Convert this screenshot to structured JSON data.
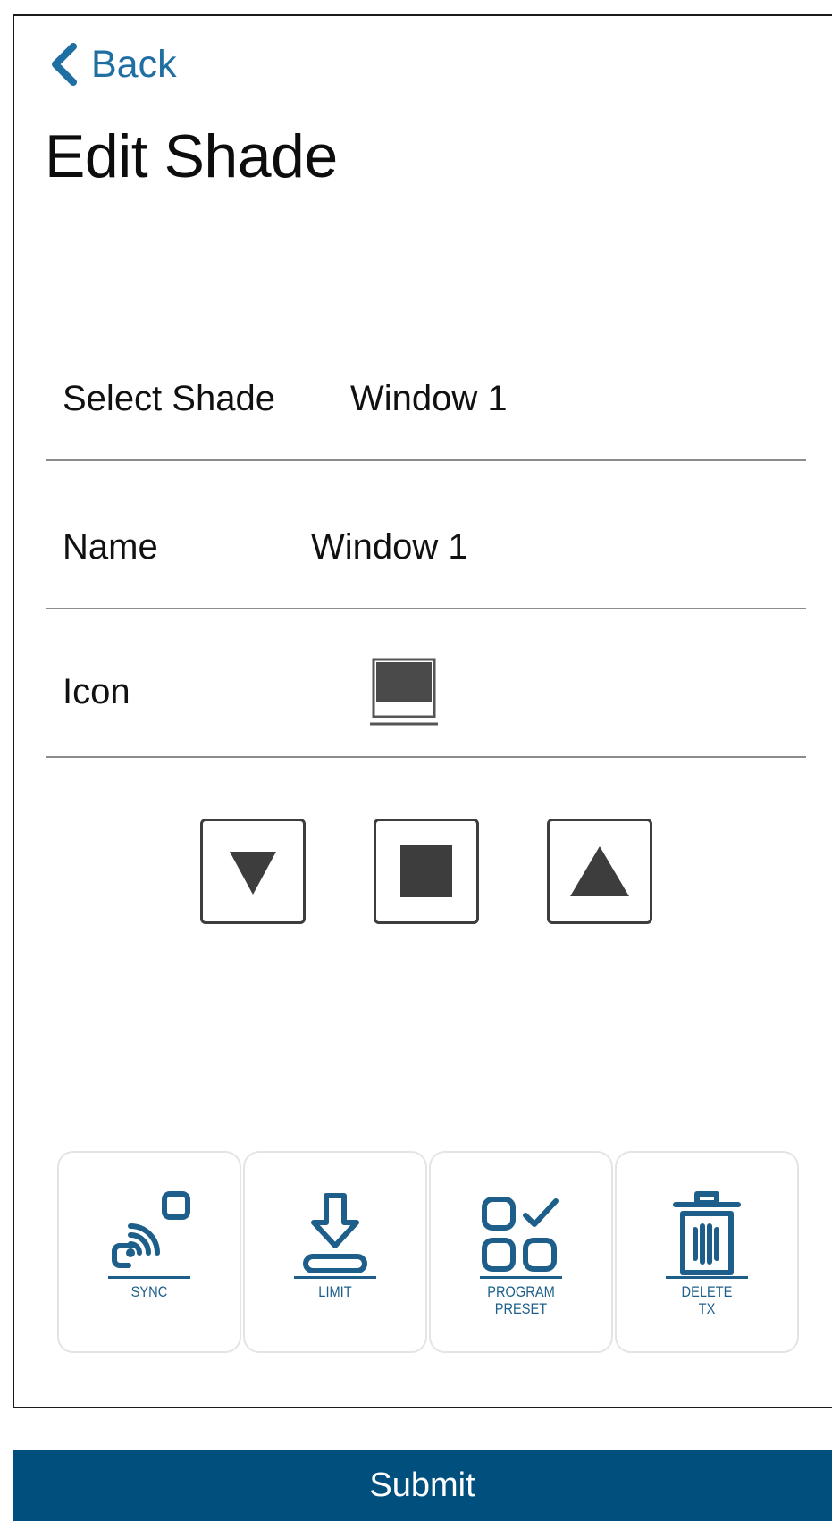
{
  "header": {
    "back_label": "Back",
    "title": "Edit Shade"
  },
  "form": {
    "select_shade": {
      "label": "Select Shade",
      "value": "Window 1"
    },
    "name": {
      "label": "Name",
      "value": "Window 1"
    },
    "icon": {
      "label": "Icon",
      "icon_name": "window-shade-icon"
    }
  },
  "controls": {
    "down_icon": "triangle-down-icon",
    "stop_icon": "square-stop-icon",
    "up_icon": "triangle-up-icon"
  },
  "actions": [
    {
      "label_lines": [
        "SYNC"
      ],
      "icon": "sync-signal-icon"
    },
    {
      "label_lines": [
        "LIMIT"
      ],
      "icon": "download-limit-icon"
    },
    {
      "label_lines": [
        "PROGRAM",
        "PRESET"
      ],
      "icon": "grid-check-icon"
    },
    {
      "label_lines": [
        "DELETE",
        "TX"
      ],
      "icon": "trash-icon"
    }
  ],
  "footer": {
    "submit_label": "Submit"
  },
  "colors": {
    "accent": "#004f7c",
    "link": "#1f6fa3",
    "icon_blue": "#1d5f8a",
    "control_fill": "#3d3d3d"
  }
}
